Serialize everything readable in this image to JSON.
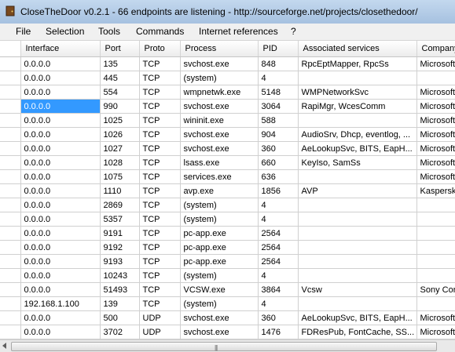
{
  "window": {
    "title": "CloseTheDoor v0.2.1 - 66 endpoints are listening - http://sourceforge.net/projects/closethedoor/"
  },
  "menu": [
    "File",
    "Selection",
    "Tools",
    "Commands",
    "Internet references",
    "?"
  ],
  "columns": [
    "Interface",
    "Port",
    "Proto",
    "Process",
    "PID",
    "Associated services",
    "Company"
  ],
  "selected_row": 3,
  "rows": [
    [
      "0.0.0.0",
      "135",
      "TCP",
      "svchost.exe",
      "848",
      "RpcEptMapper, RpcSs",
      "Microsoft C"
    ],
    [
      "0.0.0.0",
      "445",
      "TCP",
      "(system)",
      "4",
      "",
      ""
    ],
    [
      "0.0.0.0",
      "554",
      "TCP",
      "wmpnetwk.exe",
      "5148",
      "WMPNetworkSvc",
      "Microsoft C"
    ],
    [
      "0.0.0.0",
      "990",
      "TCP",
      "svchost.exe",
      "3064",
      "RapiMgr, WcesComm",
      "Microsoft C"
    ],
    [
      "0.0.0.0",
      "1025",
      "TCP",
      "wininit.exe",
      "588",
      "",
      "Microsoft C"
    ],
    [
      "0.0.0.0",
      "1026",
      "TCP",
      "svchost.exe",
      "904",
      "AudioSrv, Dhcp, eventlog, ...",
      "Microsoft C"
    ],
    [
      "0.0.0.0",
      "1027",
      "TCP",
      "svchost.exe",
      "360",
      "AeLookupSvc, BITS, EapH...",
      "Microsoft C"
    ],
    [
      "0.0.0.0",
      "1028",
      "TCP",
      "lsass.exe",
      "660",
      "KeyIso, SamSs",
      "Microsoft C"
    ],
    [
      "0.0.0.0",
      "1075",
      "TCP",
      "services.exe",
      "636",
      "",
      "Microsoft C"
    ],
    [
      "0.0.0.0",
      "1110",
      "TCP",
      "avp.exe",
      "1856",
      "AVP",
      "Kaspersky"
    ],
    [
      "0.0.0.0",
      "2869",
      "TCP",
      "(system)",
      "4",
      "",
      ""
    ],
    [
      "0.0.0.0",
      "5357",
      "TCP",
      "(system)",
      "4",
      "",
      ""
    ],
    [
      "0.0.0.0",
      "9191",
      "TCP",
      "pc-app.exe",
      "2564",
      "",
      ""
    ],
    [
      "0.0.0.0",
      "9192",
      "TCP",
      "pc-app.exe",
      "2564",
      "",
      ""
    ],
    [
      "0.0.0.0",
      "9193",
      "TCP",
      "pc-app.exe",
      "2564",
      "",
      ""
    ],
    [
      "0.0.0.0",
      "10243",
      "TCP",
      "(system)",
      "4",
      "",
      ""
    ],
    [
      "0.0.0.0",
      "51493",
      "TCP",
      "VCSW.exe",
      "3864",
      "Vcsw",
      "Sony Corp"
    ],
    [
      "192.168.1.100",
      "139",
      "TCP",
      "(system)",
      "4",
      "",
      ""
    ],
    [
      "0.0.0.0",
      "500",
      "UDP",
      "svchost.exe",
      "360",
      "AeLookupSvc, BITS, EapH...",
      "Microsoft C"
    ],
    [
      "0.0.0.0",
      "3702",
      "UDP",
      "svchost.exe",
      "1476",
      "FDResPub, FontCache, SS...",
      "Microsoft C"
    ]
  ],
  "colors": {
    "selection": "#3399ff",
    "titlebar": "#b6cde8"
  },
  "icons": {
    "app": "door-icon",
    "scroll_left": "arrow-left-icon",
    "scroll_grip": "grip-icon"
  }
}
